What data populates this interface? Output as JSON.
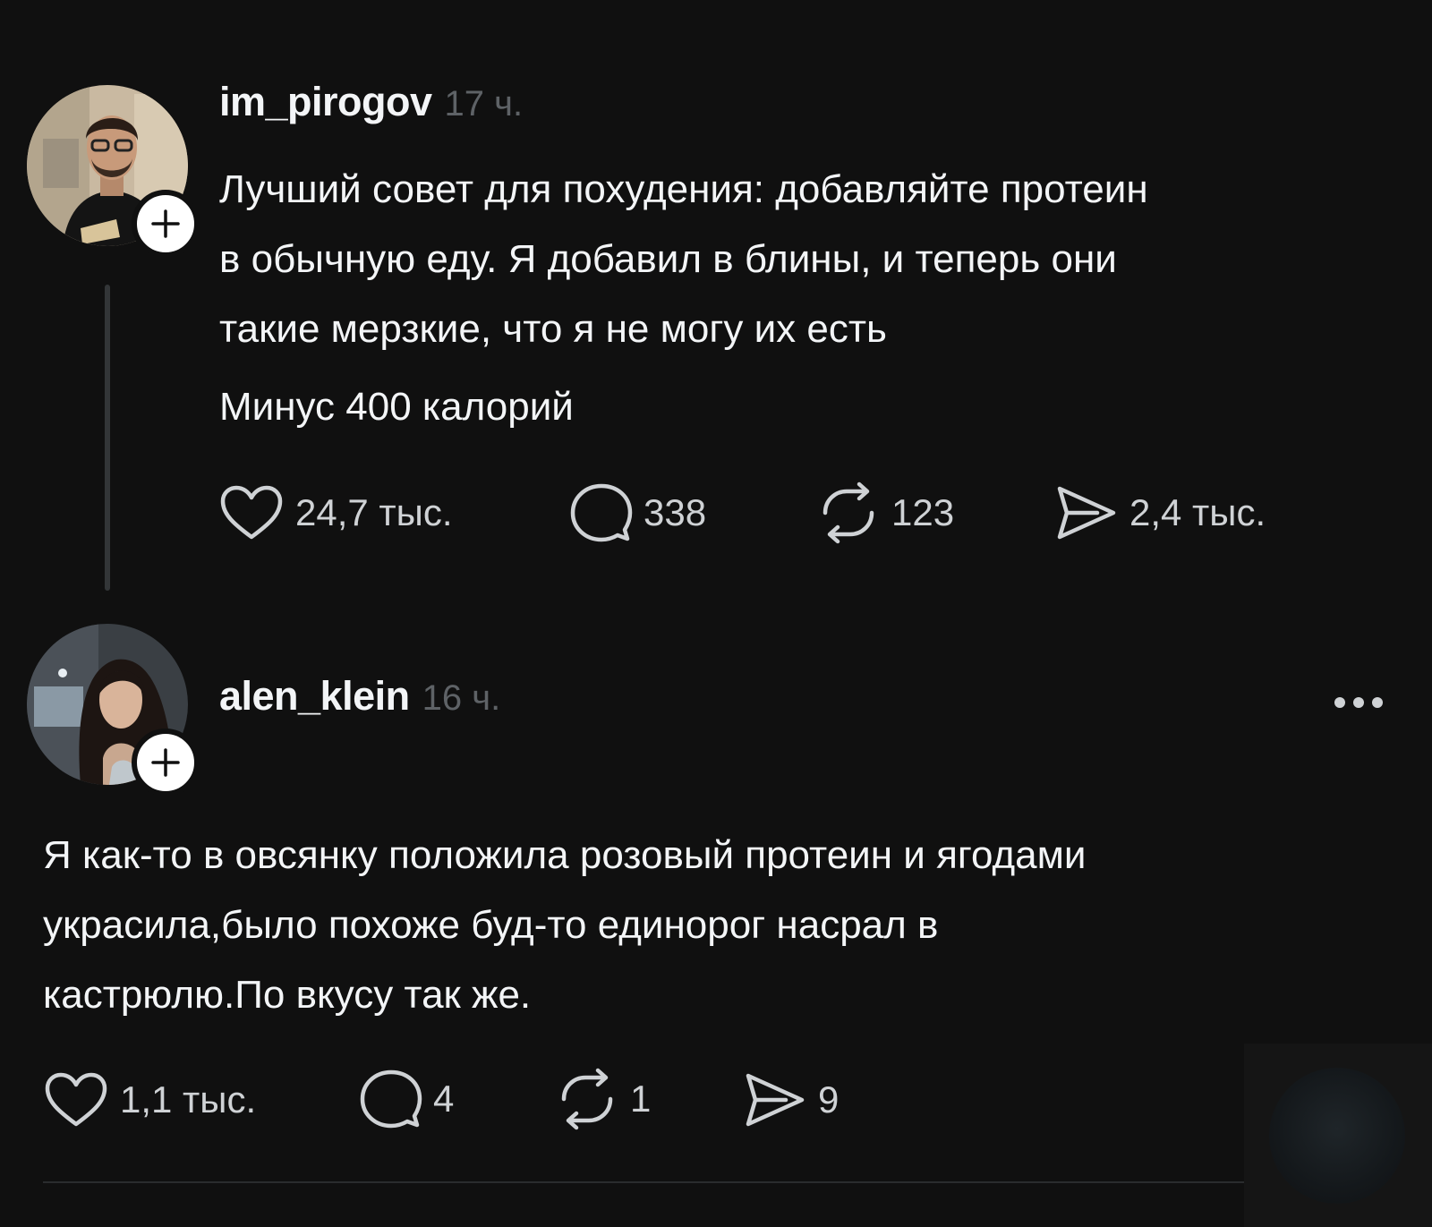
{
  "posts": [
    {
      "username": "im_pirogov",
      "time": "17 ч.",
      "text_lines": [
        "Лучший совет для похудения: добавляйте протеин",
        "в обычную еду. Я добавил в блины, и теперь они",
        "такие мерзкие, что я не могу их есть",
        "Минус 400 калорий"
      ],
      "likes": "24,7 тыс.",
      "comments": "338",
      "reposts": "123",
      "shares": "2,4 тыс."
    },
    {
      "username": "alen_klein",
      "time": "16 ч.",
      "text_lines": [
        "Я как-то в овсянку положила розовый протеин и ягодами",
        "украсила,было похоже буд-то единорог насрал в",
        "кастрюлю.По вкусу так же."
      ],
      "likes": "1,1 тыс.",
      "comments": "4",
      "reposts": "1",
      "shares": "9"
    }
  ],
  "icons": {
    "like": "heart-icon",
    "comment": "speech-bubble-icon",
    "repost": "repost-arrows-icon",
    "share": "paper-plane-icon",
    "follow": "plus-icon",
    "more": "more-dots-icon"
  },
  "colors": {
    "background": "#101010",
    "text": "#f3f5f7",
    "muted": "#5e6266",
    "counts": "#cfd2d5",
    "thread_line": "#333638"
  }
}
